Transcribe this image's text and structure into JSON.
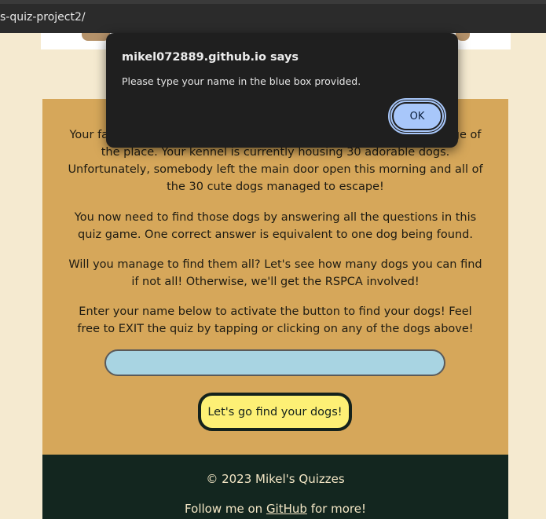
{
  "browser": {
    "url": "s-quiz-project2/"
  },
  "intro": {
    "p1": "Your family's kennel was left in your care, and you were left in-charge of the place. Your kennel is currently housing 30 adorable dogs. Unfortunately, somebody left the main door open this morning and all of the 30 cute dogs managed to escape!",
    "p2": "You now need to find those dogs by answering all the questions in this quiz game. One correct answer is equivalent to one dog being found.",
    "p3": "Will you manage to find them all? Let's see how many dogs you can find if not all! Otherwise, we'll get the RSPCA involved!",
    "p4": "Enter your name below to activate the button to find your dogs! Feel free to EXIT the quiz by tapping or clicking on any of the dogs above!"
  },
  "form": {
    "name_value": "",
    "go_label": "Let's go find your dogs!"
  },
  "footer": {
    "copyright": "© 2023 Mikel's Quizzes",
    "follow_prefix": "Follow me on ",
    "github_link": "GitHub",
    "follow_suffix": " for more!"
  },
  "dialog": {
    "title": "mikel072889.github.io says",
    "message": "Please type your name in the blue box provided.",
    "ok_label": "OK"
  },
  "colors": {
    "page_bg": "#f5ead0",
    "card_bg": "#d6a75a",
    "input_bg": "#a8d4e2",
    "button_bg": "#fdf075",
    "footer_bg": "#13261f",
    "dialog_bg": "#1f1f1f",
    "ok_bg": "#a8c7fa"
  }
}
